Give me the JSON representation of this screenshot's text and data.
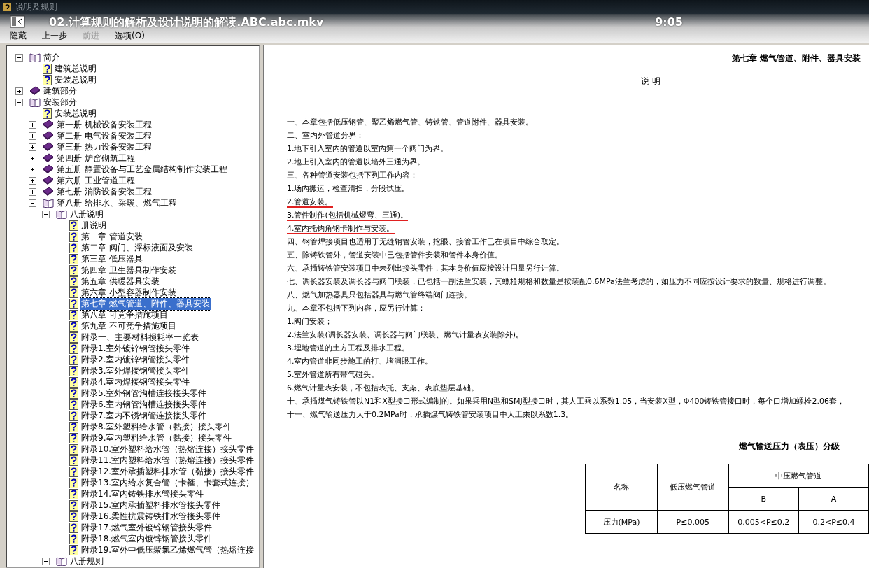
{
  "window": {
    "title": "说明及规则"
  },
  "video_overlay": {
    "filename": "02.计算规则的解析及设计说明的解读.ABC.abc.mkv",
    "time": "9:05"
  },
  "toolbar": [
    {
      "label": "隐藏",
      "disabled": false
    },
    {
      "label": "上一步",
      "disabled": false
    },
    {
      "label": "前进",
      "disabled": true
    },
    {
      "label": "选项(O)",
      "disabled": false
    }
  ],
  "tree": [
    {
      "kind": "book",
      "label": "简介",
      "expanded": true,
      "selected": false,
      "children": [
        {
          "kind": "page",
          "label": "建筑总说明",
          "selected": false
        },
        {
          "kind": "page",
          "label": "安装总说明",
          "selected": false
        }
      ]
    },
    {
      "kind": "book",
      "label": "建筑部分",
      "expanded": false,
      "selected": false
    },
    {
      "kind": "book",
      "label": "安装部分",
      "expanded": true,
      "selected": false,
      "children": [
        {
          "kind": "page",
          "label": "安装总说明",
          "selected": false
        },
        {
          "kind": "book",
          "label": "第一册 机械设备安装工程",
          "expanded": false,
          "selected": false
        },
        {
          "kind": "book",
          "label": "第二册 电气设备安装工程",
          "expanded": false,
          "selected": false
        },
        {
          "kind": "book",
          "label": "第三册 热力设备安装工程",
          "expanded": false,
          "selected": false
        },
        {
          "kind": "book",
          "label": "第四册 炉窑砌筑工程",
          "expanded": false,
          "selected": false
        },
        {
          "kind": "book",
          "label": "第五册 静置设备与工艺金属结构制作安装工程",
          "expanded": false,
          "selected": false
        },
        {
          "kind": "book",
          "label": "第六册 工业管道工程",
          "expanded": false,
          "selected": false
        },
        {
          "kind": "book",
          "label": "第七册 消防设备安装工程",
          "expanded": false,
          "selected": false
        },
        {
          "kind": "book",
          "label": "第八册 给排水、采暖、燃气工程",
          "expanded": true,
          "selected": false,
          "children": [
            {
              "kind": "book",
              "label": "八册说明",
              "expanded": true,
              "selected": false,
              "children": [
                {
                  "kind": "page",
                  "label": "册说明",
                  "selected": false
                },
                {
                  "kind": "page",
                  "label": "第一章 管道安装",
                  "selected": false
                },
                {
                  "kind": "page",
                  "label": "第二章 阀门、浮标液面及安装",
                  "selected": false
                },
                {
                  "kind": "page",
                  "label": "第三章 低压器具",
                  "selected": false
                },
                {
                  "kind": "page",
                  "label": "第四章 卫生器具制作安装",
                  "selected": false
                },
                {
                  "kind": "page",
                  "label": "第五章 供暖器具安装",
                  "selected": false
                },
                {
                  "kind": "page",
                  "label": "第六章 小型容器制作安装",
                  "selected": false
                },
                {
                  "kind": "page",
                  "label": "第七章 燃气管道、附件、器具安装",
                  "selected": true
                },
                {
                  "kind": "page",
                  "label": "第八章 可竞争措施项目",
                  "selected": false
                },
                {
                  "kind": "page",
                  "label": "第九章 不可竞争措施项目",
                  "selected": false
                },
                {
                  "kind": "page",
                  "label": "附录一、主要材料损耗率一览表",
                  "selected": false
                },
                {
                  "kind": "page",
                  "label": "附录1.室外镀锌钢管接头零件",
                  "selected": false
                },
                {
                  "kind": "page",
                  "label": "附录2.室内镀锌钢管接头零件",
                  "selected": false
                },
                {
                  "kind": "page",
                  "label": "附录3.室外焊接钢管接头零件",
                  "selected": false
                },
                {
                  "kind": "page",
                  "label": "附录4.室内焊接钢管接头零件",
                  "selected": false
                },
                {
                  "kind": "page",
                  "label": "附录5.室外钢管沟槽连接接头零件",
                  "selected": false
                },
                {
                  "kind": "page",
                  "label": "附录6.室内钢管沟槽连接接头零件",
                  "selected": false
                },
                {
                  "kind": "page",
                  "label": "附录7.室内不锈钢管连接接头零件",
                  "selected": false
                },
                {
                  "kind": "page",
                  "label": "附录8.室外塑料给水管（黏接）接头零件",
                  "selected": false
                },
                {
                  "kind": "page",
                  "label": "附录9.室内塑料给水管（黏接）接头零件",
                  "selected": false
                },
                {
                  "kind": "page",
                  "label": "附录10.室外塑料给水管（热熔连接）接头零件",
                  "selected": false
                },
                {
                  "kind": "page",
                  "label": "附录11.室内塑料给水管（热熔连接）接头零件",
                  "selected": false
                },
                {
                  "kind": "page",
                  "label": "附录12.室外承插塑料排水管（黏接）接头零件",
                  "selected": false
                },
                {
                  "kind": "page",
                  "label": "附录13.室内给水复合管（卡箍、卡套式连接）",
                  "selected": false
                },
                {
                  "kind": "page",
                  "label": "附录14.室内铸铁排水管接头零件",
                  "selected": false
                },
                {
                  "kind": "page",
                  "label": "附录15.室内承插塑料排水管接头零件",
                  "selected": false
                },
                {
                  "kind": "page",
                  "label": "附录16.柔性抗震铸铁排水管接头零件",
                  "selected": false
                },
                {
                  "kind": "page",
                  "label": "附录17.燃气室外镀锌钢管接头零件",
                  "selected": false
                },
                {
                  "kind": "page",
                  "label": "附录18.燃气室内镀锌钢管接头零件",
                  "selected": false
                },
                {
                  "kind": "page",
                  "label": "附录19.室外中低压聚氯乙烯燃气管（热熔连接",
                  "selected": false
                }
              ]
            },
            {
              "kind": "book",
              "label": "八册规则",
              "expanded": true,
              "selected": false
            }
          ]
        }
      ]
    }
  ],
  "document": {
    "chapter_title": "第七章 燃气管道、附件、器具安装",
    "section_title": "说 明",
    "paragraphs": [
      {
        "text": "一、本章包括低压钢管、聚乙烯燃气管、铸铁管、管道附件、器具安装。",
        "annotated": false
      },
      {
        "text": "二、室内外管道分界：",
        "annotated": false
      },
      {
        "text": "1.地下引入室内的管道以室内第一个阀门为界。",
        "annotated": false
      },
      {
        "text": "2.地上引入室内的管道以墙外三通为界。",
        "annotated": false
      },
      {
        "text": "三、各种管道安装包括下列工作内容：",
        "annotated": false
      },
      {
        "text": "1.场内搬运，检查清扫，分段试压。",
        "annotated": false
      },
      {
        "text": "2.管道安装。",
        "annotated": true
      },
      {
        "text": "3.管件制作(包括机械煨弯、三通)。",
        "annotated": true
      },
      {
        "text": "4.室内托钩角钢卡制作与安装。",
        "annotated": true
      },
      {
        "text": "四、钢管焊接项目也适用于无缝钢管安装，挖眼、接管工作已在项目中综合取定。",
        "annotated": false
      },
      {
        "text": "五、除铸铁管外，管道安装中已包括管件安装和管件本身价值。",
        "annotated": false
      },
      {
        "text": "六、承插铸铁管安装项目中未列出接头零件，其本身价值应按设计用量另行计算。",
        "annotated": false
      },
      {
        "text": "七、调长器安装及调长器与阀门联装，已包括一副法兰安装，其螺栓规格和数量是按装配0.6MPa法兰考虑的，如压力不同应按设计要求的数量、规格进行调整。",
        "annotated": false
      },
      {
        "text": "八、燃气加热器具只包括器具与燃气管终端阀门连接。",
        "annotated": false
      },
      {
        "text": "九、本章不包括下列内容，应另行计算：",
        "annotated": false
      },
      {
        "text": "1.阀门安装；",
        "annotated": false
      },
      {
        "text": "2.法兰安装(调长器安装、调长器与阀门联装、燃气计量表安装除外)。",
        "annotated": false
      },
      {
        "text": "3.埋地管道的土方工程及排水工程。",
        "annotated": false
      },
      {
        "text": "4.室内管道非同步施工的打、堵洞眼工作。",
        "annotated": false
      },
      {
        "text": "5.室外管道所有带气碰头。",
        "annotated": false
      },
      {
        "text": "6.燃气计量表安装，不包括表托、支架、表底垫层基础。",
        "annotated": false
      },
      {
        "text": "十、承插煤气铸铁管以N1和X型接口形式编制的。如果采用N型和SMJ型接口时，其人工乘以系数1.05，当安装X型，Φ400铸铁管接口时，每个口增加螺栓2.06套，",
        "annotated": false
      },
      {
        "text": "十一、燃气输送压力大于0.2MPa时，承插煤气铸铁管安装项目中人工乘以系数1.3。",
        "annotated": false
      }
    ],
    "table": {
      "title": "燃气输送压力（表压）分级",
      "header_name": "名称",
      "header_low": "低压燃气管道",
      "header_mid": "中压燃气管道",
      "sub_headers": [
        "B",
        "A"
      ],
      "rows": [
        [
          "压力(MPa)",
          "P≤0.005",
          "0.005<P≤0.2",
          "0.2<P≤0.4"
        ]
      ]
    }
  }
}
